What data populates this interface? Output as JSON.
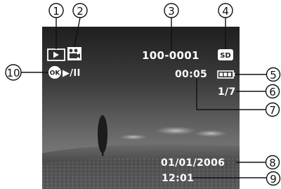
{
  "screen": {
    "file_number": "100-0001",
    "storage_badge": "SD",
    "ok_button_label": "OK",
    "play_pause_symbol": "▶/II",
    "elapsed_time": "00:05",
    "image_counter": "1/7",
    "date": "01/01/2006",
    "time": "12:01",
    "icons": [
      "playback-mode-icon",
      "movie-clip-icon",
      "sd-card-icon",
      "ok-button-icon",
      "battery-icon"
    ]
  },
  "callouts": [
    "1",
    "2",
    "3",
    "4",
    "5",
    "6",
    "7",
    "8",
    "9",
    "10"
  ]
}
